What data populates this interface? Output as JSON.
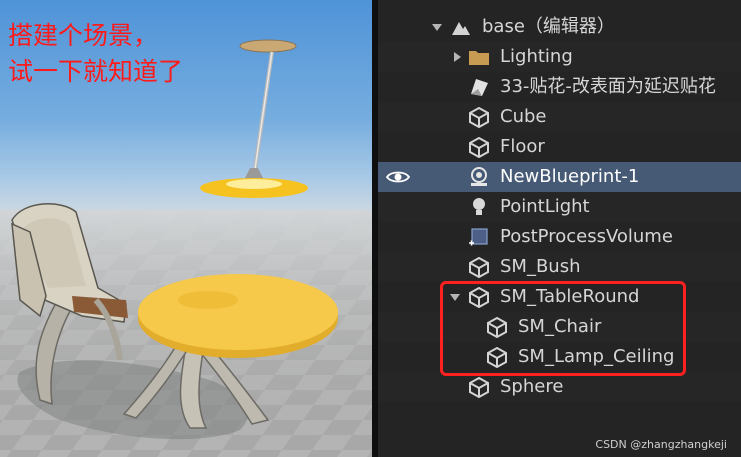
{
  "viewport": {
    "caption_line1": "搭建个场景，",
    "caption_line2": "试一下就知道了"
  },
  "outliner": {
    "rows": [
      {
        "label": "base（编辑器）",
        "icon": "level-icon",
        "expanded": true,
        "indent": 0
      },
      {
        "label": "Lighting",
        "icon": "folder-icon",
        "expanded": false,
        "indent": 1
      },
      {
        "label": "33-贴花-改表面为延迟贴花",
        "icon": "decal-icon",
        "indent": 1
      },
      {
        "label": "Cube",
        "icon": "static-mesh-icon",
        "indent": 1
      },
      {
        "label": "Floor",
        "icon": "static-mesh-icon",
        "indent": 1
      },
      {
        "label": "NewBlueprint-1",
        "icon": "blueprint-icon",
        "indent": 1,
        "selected": true,
        "visible": true
      },
      {
        "label": "PointLight",
        "icon": "point-light-icon",
        "indent": 1
      },
      {
        "label": "PostProcessVolume",
        "icon": "post-process-volume-icon",
        "indent": 1
      },
      {
        "label": "SM_Bush",
        "icon": "static-mesh-icon",
        "indent": 1
      },
      {
        "label": "SM_TableRound",
        "icon": "static-mesh-icon",
        "indent": 1,
        "expanded": true
      },
      {
        "label": "SM_Chair",
        "icon": "static-mesh-icon",
        "indent": 2
      },
      {
        "label": "SM_Lamp_Ceiling",
        "icon": "static-mesh-icon",
        "indent": 2
      },
      {
        "label": "Sphere",
        "icon": "static-mesh-icon",
        "indent": 1
      }
    ]
  },
  "watermark": "CSDN @zhangzhangkeji",
  "colors": {
    "caption": "#ff1a1a",
    "selected_row": "#465a75",
    "highlight_border": "#ff2020",
    "table_top": "#f6c94a"
  }
}
